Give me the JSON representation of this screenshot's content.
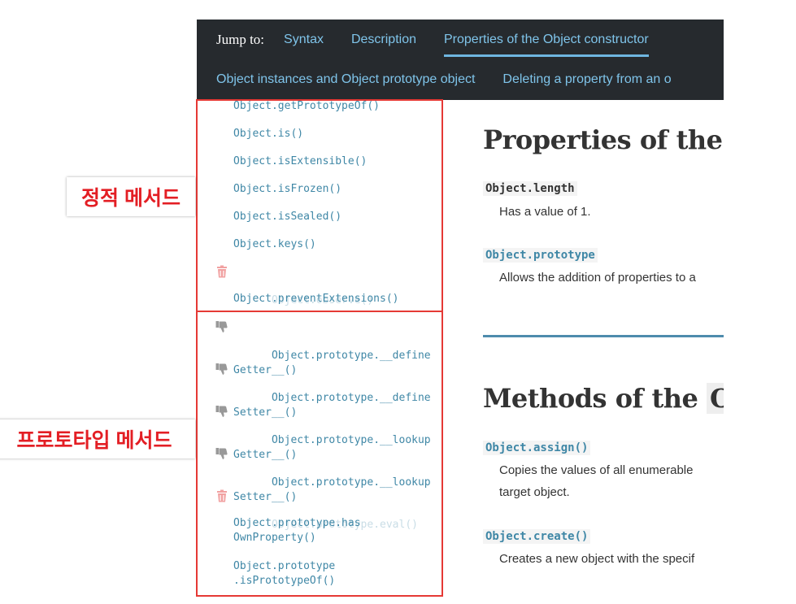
{
  "jumpbar": {
    "label": "Jump to:",
    "links": [
      "Syntax",
      "Description",
      "Properties of the Object constructor",
      "Object instances and Object prototype object",
      "Deleting a property from an o"
    ]
  },
  "sidebar": {
    "static_methods": [
      {
        "label": "Object.getPrototypeOf()",
        "obsolete": false
      },
      {
        "label": "Object.is()",
        "obsolete": false
      },
      {
        "label": "Object.isExtensible()",
        "obsolete": false
      },
      {
        "label": "Object.isFrozen()",
        "obsolete": false
      },
      {
        "label": "Object.isSealed()",
        "obsolete": false
      },
      {
        "label": "Object.keys()",
        "obsolete": false
      },
      {
        "label": "Object.observe()",
        "obsolete": true,
        "icon": "trash-icon"
      },
      {
        "label": "Object.preventExtensions()",
        "obsolete": false
      }
    ],
    "prototype_methods": [
      {
        "label": "Object.prototype.__define\nGetter__()",
        "obsolete": false,
        "icon": "thumbs-down-icon"
      },
      {
        "label": "Object.prototype.__define\nSetter__()",
        "obsolete": false,
        "icon": "thumbs-down-icon"
      },
      {
        "label": "Object.prototype.__lookup\nGetter__()",
        "obsolete": false,
        "icon": "thumbs-down-icon"
      },
      {
        "label": "Object.prototype.__lookup\nSetter__()",
        "obsolete": false,
        "icon": "thumbs-down-icon"
      },
      {
        "label": "Object.prototype.eval()",
        "obsolete": true,
        "icon": "trash-icon"
      },
      {
        "label": "Object.prototype.has\nOwnProperty()",
        "obsolete": false
      },
      {
        "label": "Object.prototype\n.isPrototypeOf()",
        "obsolete": false
      }
    ]
  },
  "main": {
    "properties_heading": "Properties of the",
    "properties": [
      {
        "term": "Object.length",
        "desc": "Has a value of 1."
      },
      {
        "term": "Object.prototype",
        "desc": "Allows the addition of properties to a"
      }
    ],
    "methods_heading": "Methods of the",
    "methods_heading_code": "O",
    "methods": [
      {
        "term": "Object.assign()",
        "desc": "Copies the values of all enumerable",
        "desc2": "target object."
      },
      {
        "term": "Object.create()",
        "desc": "Creates a new object with the specif"
      }
    ]
  },
  "annotations": {
    "static_label": "정적 메서드",
    "prototype_label": "프로토타입 메서드",
    "color": "#e31e24"
  }
}
